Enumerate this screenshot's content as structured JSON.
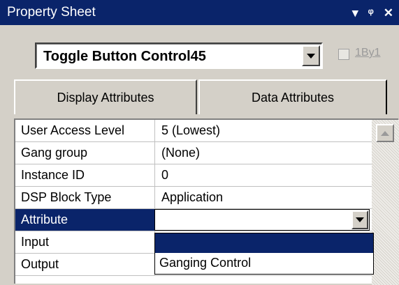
{
  "window": {
    "title": "Property Sheet",
    "buttons": {
      "menu": "▾",
      "pin": "ᵖ",
      "close": "✕"
    }
  },
  "control_selector": {
    "selected": "Toggle Button Control45",
    "option_label": "1By1",
    "option_checked": false
  },
  "tabs": [
    {
      "label": "Display Attributes",
      "active": false
    },
    {
      "label": "Data Attributes",
      "active": true
    }
  ],
  "properties": [
    {
      "name": "User Access Level",
      "value": "5 (Lowest)"
    },
    {
      "name": "Gang group",
      "value": "(None)"
    },
    {
      "name": "Instance ID",
      "value": "0"
    },
    {
      "name": "DSP Block Type",
      "value": "Application"
    },
    {
      "name": "Attribute",
      "value": "",
      "selected": true
    },
    {
      "name": "Input",
      "value": ""
    },
    {
      "name": "Output",
      "value": ""
    }
  ],
  "attribute_dropdown": {
    "value": "",
    "options": [
      "",
      "Ganging Control"
    ]
  },
  "colors": {
    "accent": "#0a246a",
    "face": "#d4d0c8"
  }
}
